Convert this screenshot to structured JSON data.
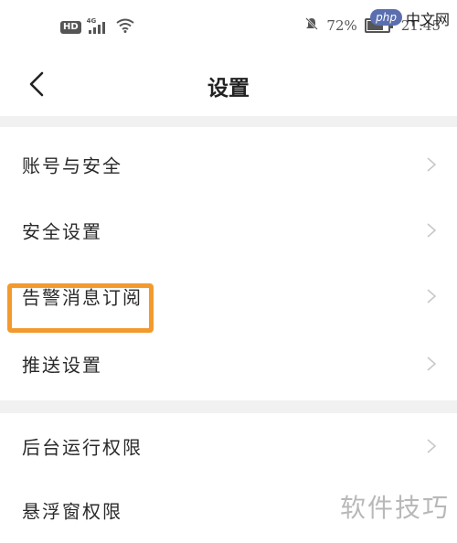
{
  "status_bar": {
    "hd": "HD",
    "net": "4G",
    "battery_pct": "72%",
    "battery_level": 0.72,
    "time": "21:45",
    "icons": [
      "signal-icon",
      "wifi-icon",
      "bell-off-icon",
      "battery-icon"
    ]
  },
  "header": {
    "title": "设置",
    "back_icon": "chevron-left-icon"
  },
  "settings": {
    "group1": [
      {
        "label": "账号与安全"
      },
      {
        "label": "安全设置"
      },
      {
        "label": "告警消息订阅"
      },
      {
        "label": "推送设置"
      }
    ],
    "group2": [
      {
        "label": "后台运行权限"
      },
      {
        "label": "悬浮窗权限"
      }
    ]
  },
  "watermarks": {
    "php_badge": "php",
    "php_site": "中文网",
    "bottom": "软件技巧"
  },
  "colors": {
    "highlight": "#f39a2e",
    "divider": "#f1f1f1"
  }
}
